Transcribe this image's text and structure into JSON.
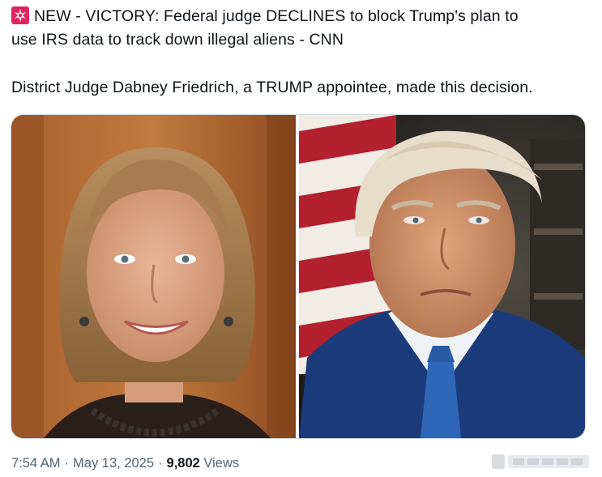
{
  "tweet": {
    "emoji_icon": "police-siren-icon",
    "line1": "NEW - VICTORY: Federal judge DECLINES to block Trump's plan to",
    "line2": "use IRS data to track down illegal aliens - CNN",
    "line3": "District Judge Dabney Friedrich, a TRUMP appointee, made this decision."
  },
  "media": {
    "left_photo": "portrait-woman-photo",
    "right_photo": "portrait-man-flag-photo"
  },
  "meta": {
    "time": "7:54 AM",
    "date": "May 13, 2025",
    "views_count": "9,802",
    "views_label": "Views"
  },
  "colors": {
    "text": "#0f1419",
    "secondary": "#536471",
    "border": "#cfd9de",
    "alarm_red": "#e0245e"
  }
}
